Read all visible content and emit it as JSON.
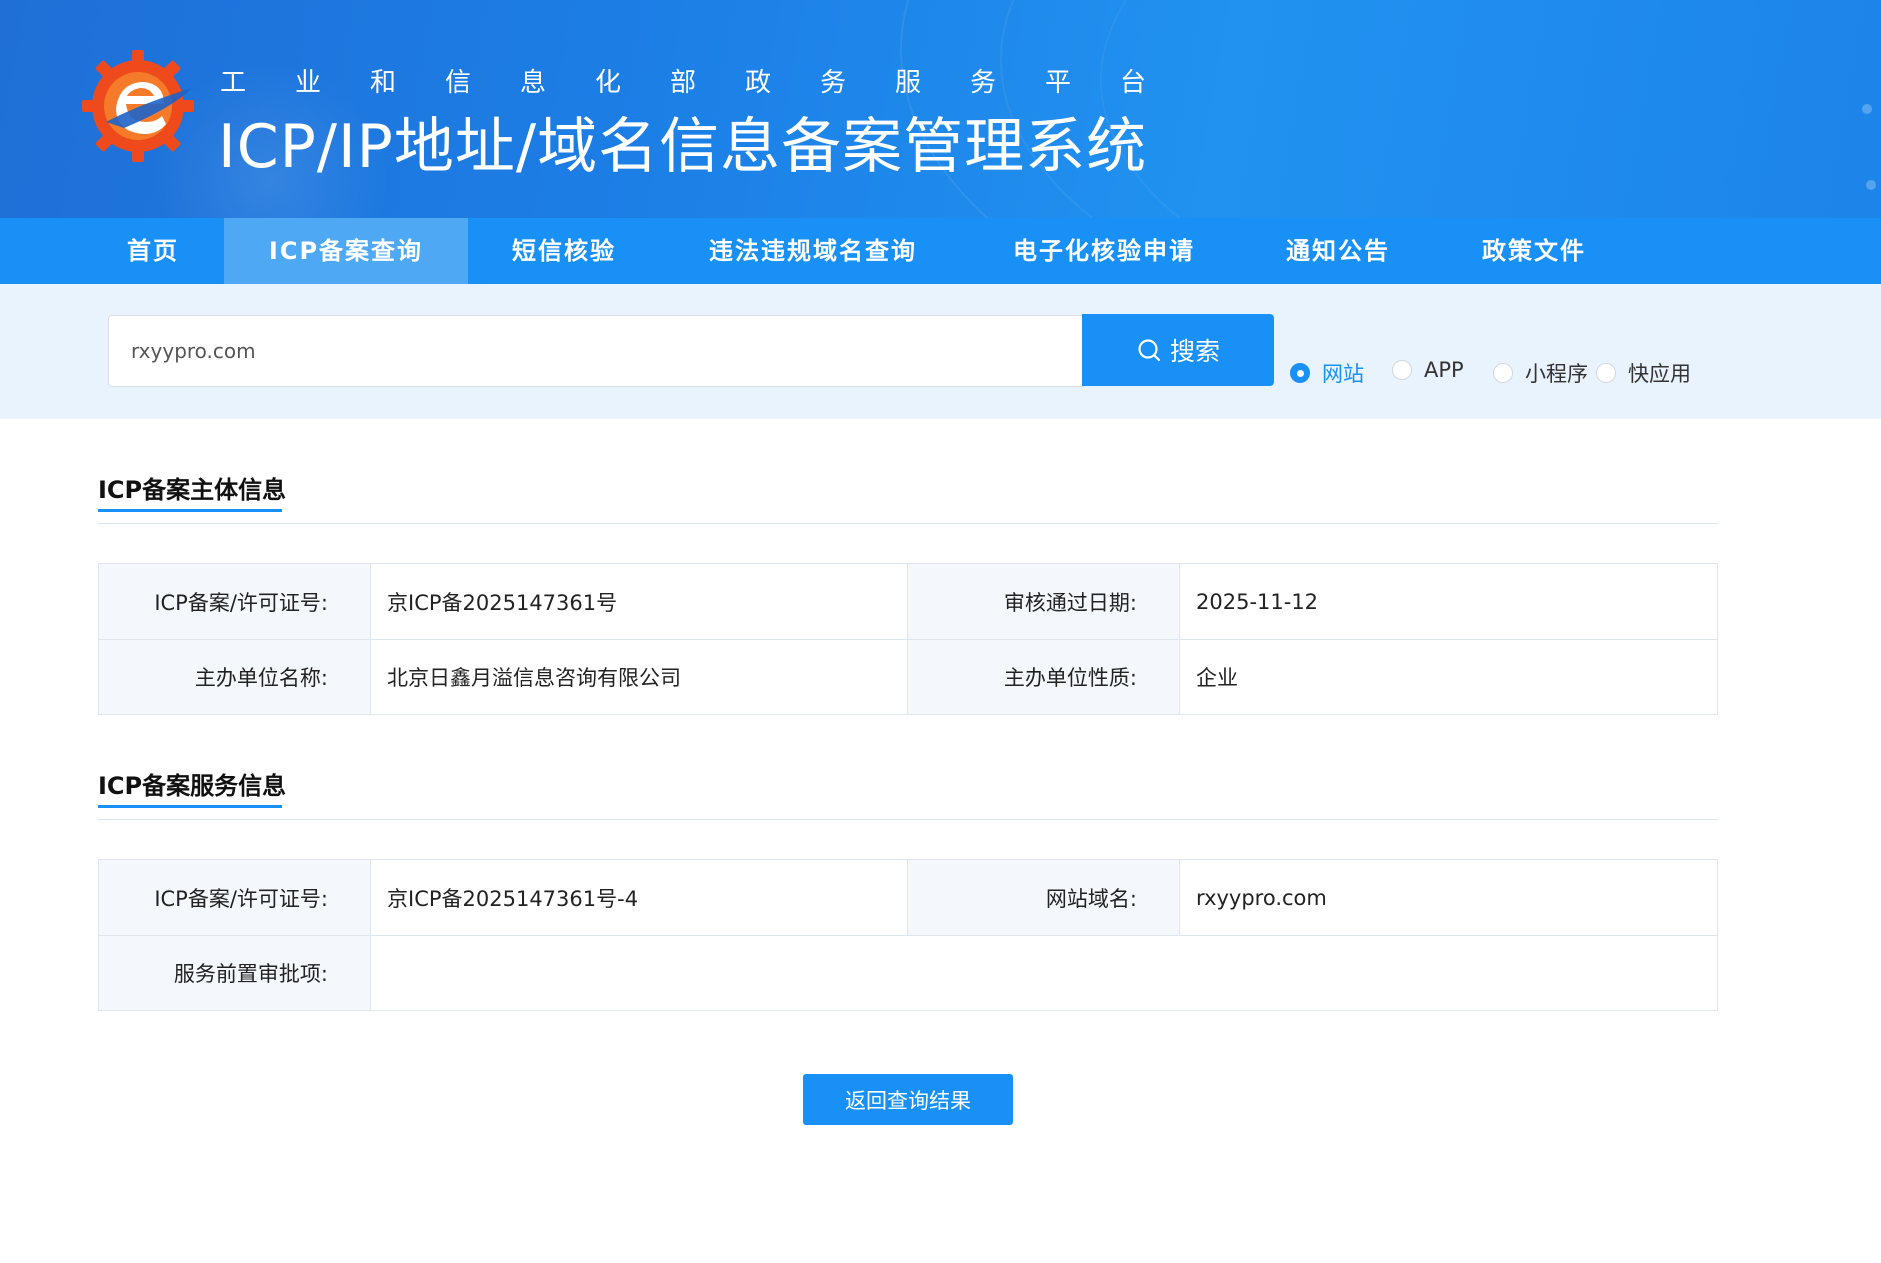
{
  "header": {
    "sub_title": "工业和信息化部政务服务平台",
    "main_title": "ICP/IP地址/域名信息备案管理系统",
    "logo_icon": "miit-gear-e-logo-icon",
    "colors": {
      "banner": "#1c7fe6",
      "nav": "#1890f6",
      "nav_active": "#4fa8f3"
    }
  },
  "nav": {
    "items": [
      {
        "label": "首页"
      },
      {
        "label": "ICP备案查询",
        "active": true
      },
      {
        "label": "短信核验"
      },
      {
        "label": "违法违规域名查询"
      },
      {
        "label": "电子化核验申请"
      },
      {
        "label": "通知公告"
      },
      {
        "label": "政策文件"
      }
    ]
  },
  "search": {
    "value": "rxyypro.com",
    "button_label": "搜索",
    "button_icon": "search-icon",
    "types": [
      {
        "label": "网站",
        "checked": true
      },
      {
        "label": "APP",
        "checked": false
      },
      {
        "label": "小程序",
        "checked": false
      },
      {
        "label": "快应用",
        "checked": false
      }
    ]
  },
  "subject_info": {
    "title": "ICP备案主体信息",
    "rows": [
      {
        "label1": "ICP备案/许可证号:",
        "value1": "京ICP备2025147361号",
        "label2": "审核通过日期:",
        "value2": "2025-11-12"
      },
      {
        "label1": "主办单位名称:",
        "value1": "北京日鑫月溢信息咨询有限公司",
        "label2": "主办单位性质:",
        "value2": "企业"
      }
    ]
  },
  "service_info": {
    "title": "ICP备案服务信息",
    "rows": [
      {
        "label1": "ICP备案/许可证号:",
        "value1": "京ICP备2025147361号-4",
        "label2": "网站域名:",
        "value2": "rxyypro.com"
      },
      {
        "label1": "服务前置审批项:",
        "value1": ""
      }
    ]
  },
  "back_button_label": "返回查询结果"
}
